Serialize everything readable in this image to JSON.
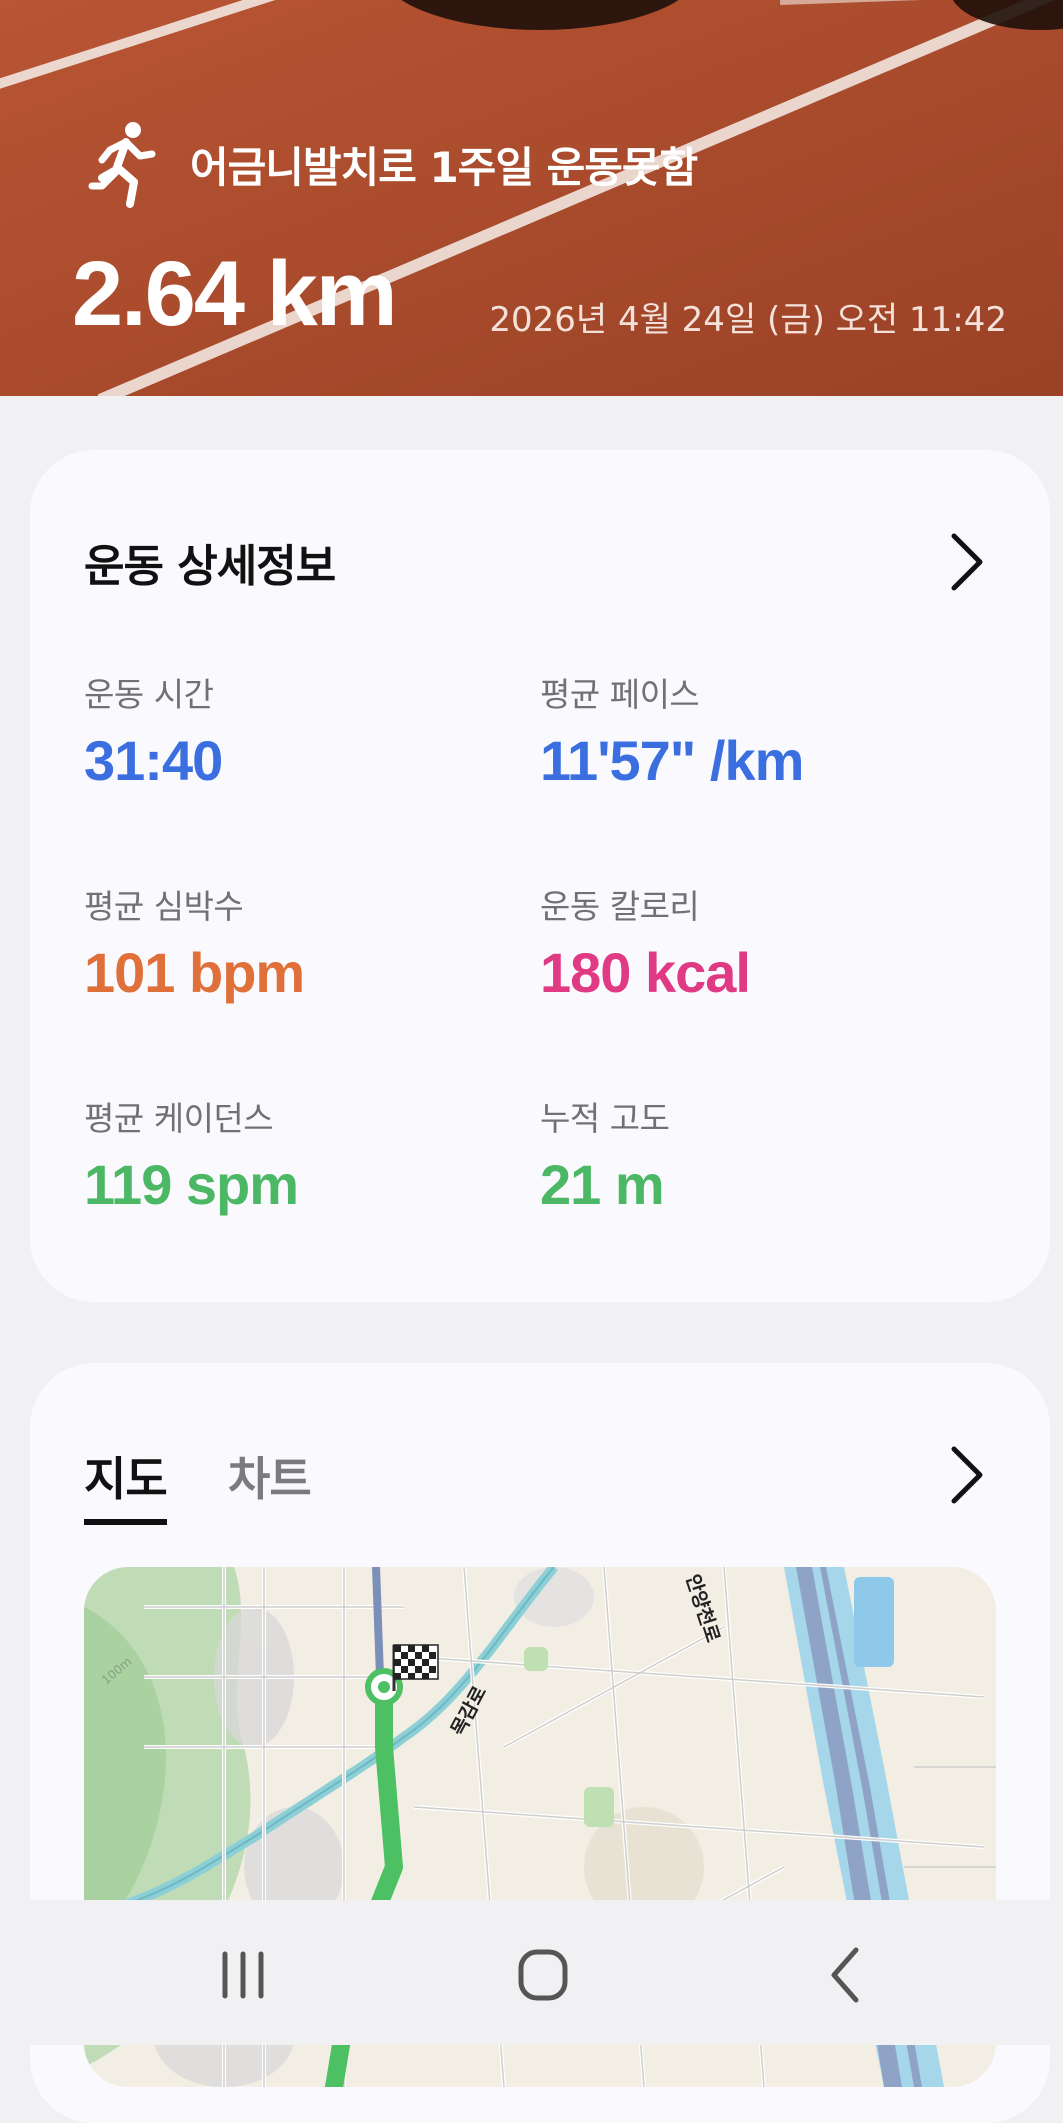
{
  "hero": {
    "title": "어금니발치로 1주일 운동못함",
    "distance": "2.64 km",
    "datetime": "2026년 4월 24일 (금) 오전 11:42",
    "icon": "running-person-icon"
  },
  "details": {
    "title": "운동 상세정보",
    "metrics": [
      {
        "label": "운동 시간",
        "value": "31:40",
        "color": "#3b6fe0"
      },
      {
        "label": "평균 페이스",
        "value": "11'57\" /km",
        "color": "#3b6fe0"
      },
      {
        "label": "평균 심박수",
        "value": "101 bpm",
        "color": "#e0703a"
      },
      {
        "label": "운동 칼로리",
        "value": "180 kcal",
        "color": "#e03a84"
      },
      {
        "label": "평균 케이던스",
        "value": "119 spm",
        "color": "#4cb866"
      },
      {
        "label": "누적 고도",
        "value": "21 m",
        "color": "#4cb866"
      }
    ]
  },
  "map_card": {
    "tabs": [
      {
        "label": "지도",
        "active": true
      },
      {
        "label": "차트",
        "active": false
      }
    ],
    "map_labels": {
      "road1": "목감로",
      "road2": "안양천로",
      "contour": "100m"
    },
    "route_color": "#4cc063"
  },
  "navbar": {
    "recent_icon": "recent-apps-icon",
    "home_icon": "home-icon",
    "back_icon": "back-icon"
  }
}
